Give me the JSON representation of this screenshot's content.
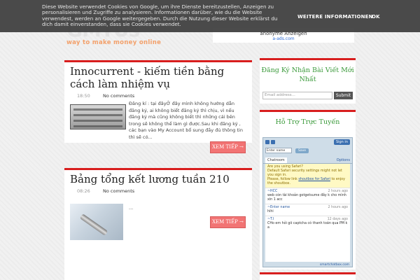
{
  "cookie_bar": {
    "text": "Diese Website verwendet Cookies von Google, um ihre Dienste bereitzustellen, Anzeigen zu personalisieren und Zugriffe zu analysieren. Informationen darüber, wie du die Website verwendest, werden an Google weitergegeben. Durch die Nutzung dieser Website erklärst du dich damit einverstanden, dass sie Cookies verwendet.",
    "more_label": "WEITERE INFORMATIONEN",
    "ok_label": "OK"
  },
  "header": {
    "logo_text": "GMTUs",
    "tagline": "way to make money online",
    "ad_label": "anonyme Anzeigen",
    "ad_link": "a-ads.com"
  },
  "posts": [
    {
      "title": "Innocurrent - kiếm tiền bằng cách làm nhiệm vụ",
      "time": "18:50",
      "comments": "No comments",
      "excerpt": "Đăng kí : tại đâyỞ đây mình không hướng dẫn đăng ký, ai không biết đăng ký thì chịu, vì nếu đăng ký mà cũng không biết thì những cái bên trong sẽ không thể làm gì được.Sau khi đăng ký , các bạn vào My Account bổ sung đầy đủ thông tin thì sẽ có...",
      "read_more": "XEM TIẾP →"
    },
    {
      "title": "Bảng tổng kết lương tuần 210",
      "time": "08:26",
      "comments": "No comments",
      "excerpt": "...",
      "read_more": "XEM TIẾP →"
    }
  ],
  "sidebar": {
    "subscribe_title": "Đăng Ký Nhận Bài Viết Mới Nhất",
    "email_placeholder": "Email address...",
    "submit_label": "Submit",
    "support_title": "Hỗ Trợ Trực Tuyến",
    "chat": {
      "sign_in": "Sign in",
      "name_value": "Enter name",
      "save_label": "Save",
      "tab_label": "Chatroom",
      "options_label": "Options",
      "notice_lines": [
        "Are you using Safari?",
        "Default Safari security settings might not let you sign in.",
        "Please, follow link",
        "to enjoy the shoutbox."
      ],
      "notice_link": "shoutbox for Safari",
      "messages": [
        {
          "name": "~HCC",
          "time": "2 hours ago",
          "text": "web còn tài khoản gotgetsume đầy k cho mình xin 1 acc"
        },
        {
          "name": "~Enter name",
          "time": "2 hours ago",
          "text": "hihi"
        },
        {
          "name": "~T.I",
          "time": "12 days ago",
          "text": "CHo em hỏi gõ captcha có thanh toán qua PM k a"
        }
      ],
      "footer": "smartchatbox.com"
    }
  },
  "colors": {
    "accent": "#d81e1e",
    "read_more_bg": "#f27474",
    "widget_title": "#3a9a3a"
  }
}
